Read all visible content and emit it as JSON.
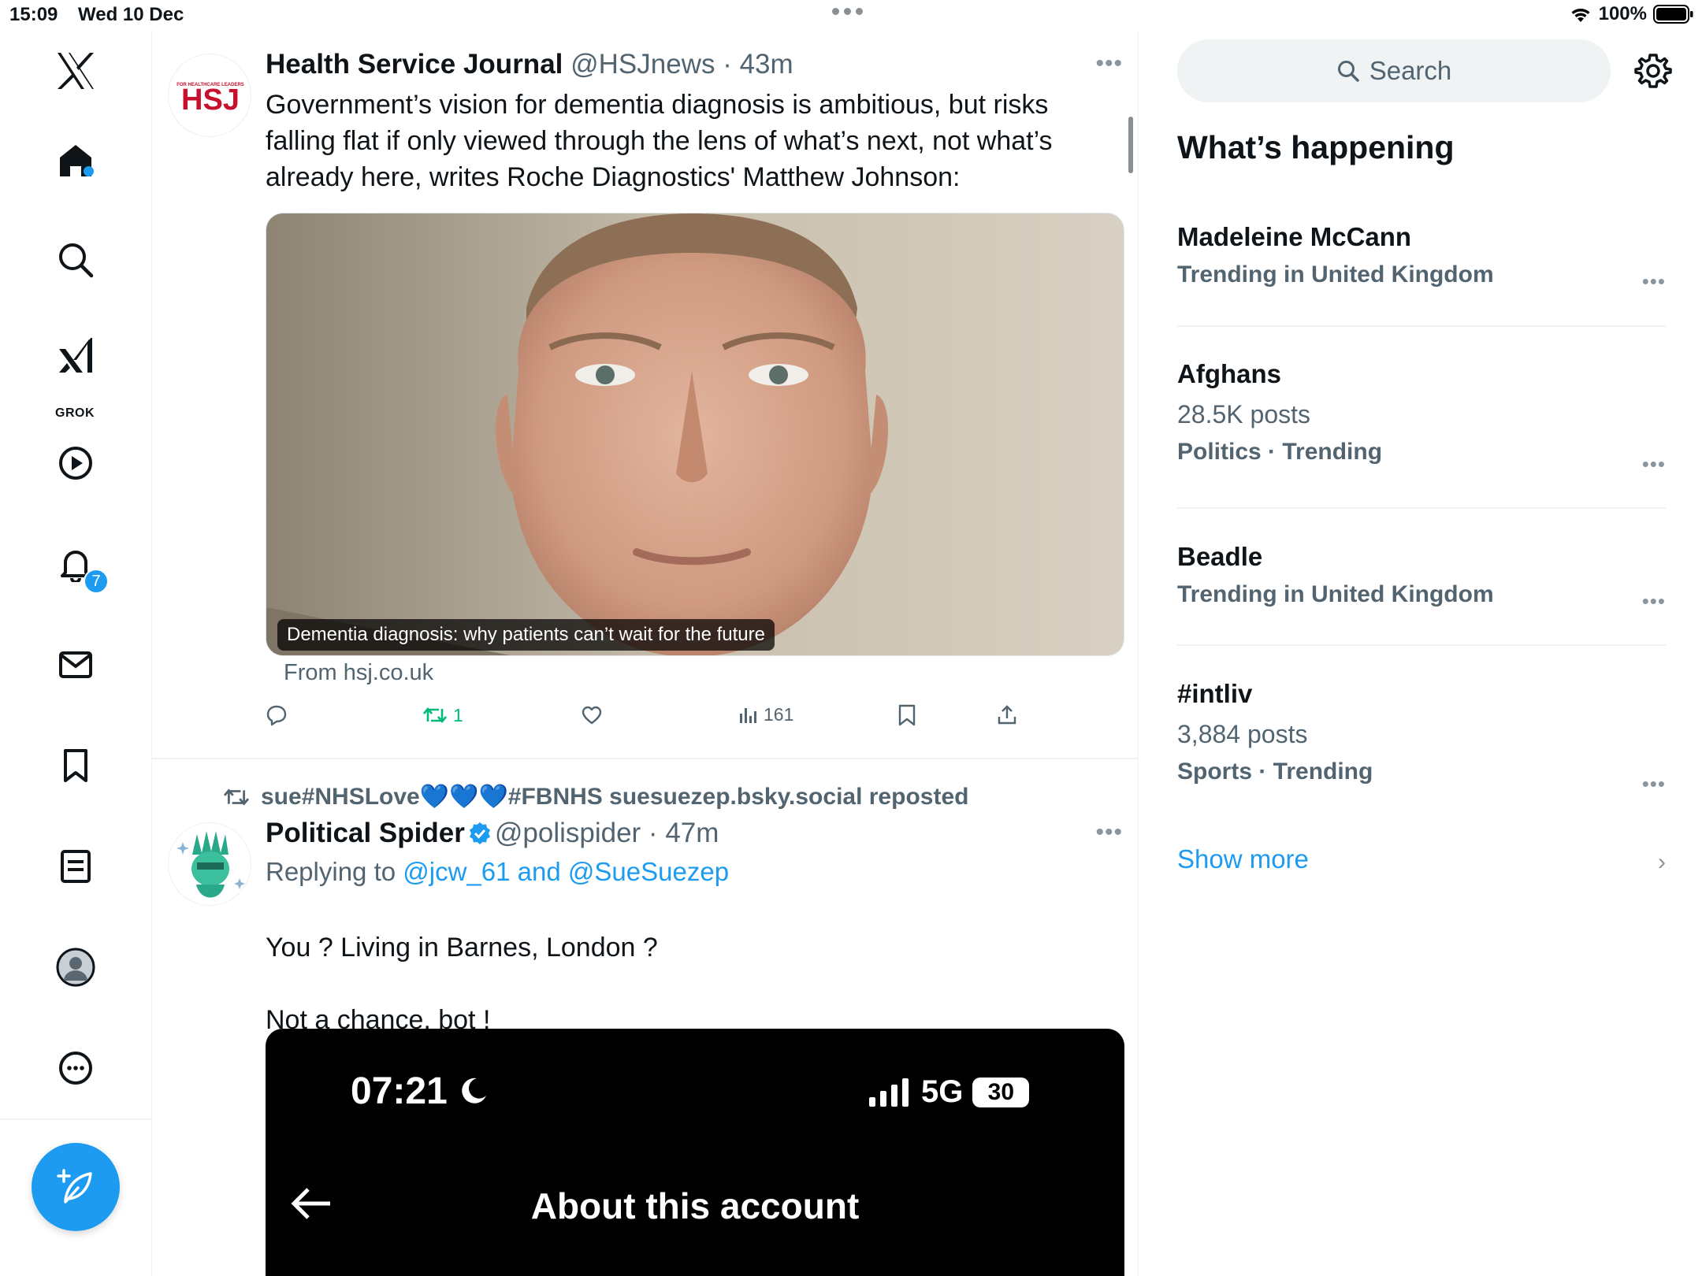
{
  "status_bar": {
    "time": "15:09",
    "date": "Wed 10 Dec",
    "battery": "100%"
  },
  "nav": {
    "items": [
      {
        "name": "x-logo"
      },
      {
        "name": "home"
      },
      {
        "name": "explore"
      },
      {
        "name": "grok",
        "label": "GROK"
      },
      {
        "name": "video"
      },
      {
        "name": "notifications",
        "badge": "7"
      },
      {
        "name": "messages"
      },
      {
        "name": "bookmarks"
      },
      {
        "name": "lists"
      },
      {
        "name": "profile"
      },
      {
        "name": "more"
      }
    ]
  },
  "posts": [
    {
      "author": "Health Service Journal",
      "handle": "@HSJnews",
      "time": "43m",
      "avatar_text": "HSJ",
      "avatar_subtext": "FOR HEALTHCARE LEADERS",
      "text": "Government’s vision for dementia diagnosis is ambitious, but risks falling flat if only viewed through the lens of what’s next, not what’s already here, writes Roche Diagnostics' Matthew Johnson:",
      "card": {
        "caption": "Dementia diagnosis: why patients can’t wait for the future",
        "source": "From hsj.co.uk"
      },
      "actions": {
        "replies": "",
        "reposts": "1",
        "likes": "",
        "views": "161"
      }
    },
    {
      "repost_by": "sue#NHSLove💙💙💙#FBNHS suesuezep.bsky.social reposted",
      "author": "Political Spider",
      "handle": "@polispider",
      "time": "47m",
      "reply_prefix": "Replying to ",
      "reply_user1": "@jcw_61",
      "reply_and": " and ",
      "reply_user2": "@SueSuezep",
      "text_line1": "You ? Living in Barnes, London ?",
      "text_line2": "Not a chance, bot !",
      "screenshot": {
        "time": "07:21",
        "network": "5G",
        "battery": "30",
        "title": "About this account"
      }
    }
  ],
  "sidebar": {
    "search_placeholder": "Search",
    "heading": "What’s happening",
    "trends": [
      {
        "title": "Madeleine McCann",
        "sub": "",
        "context": "Trending in United Kingdom"
      },
      {
        "title": "Afghans",
        "sub": "28.5K posts",
        "context": "Politics · Trending"
      },
      {
        "title": "Beadle",
        "sub": "",
        "context": "Trending in United Kingdom"
      },
      {
        "title": "#intliv",
        "sub": "3,884 posts",
        "context": "Sports · Trending"
      }
    ],
    "show_more": "Show more"
  },
  "colors": {
    "accent": "#1d9bf0",
    "repost_green": "#00ba7c",
    "secondary_text": "#536471"
  }
}
